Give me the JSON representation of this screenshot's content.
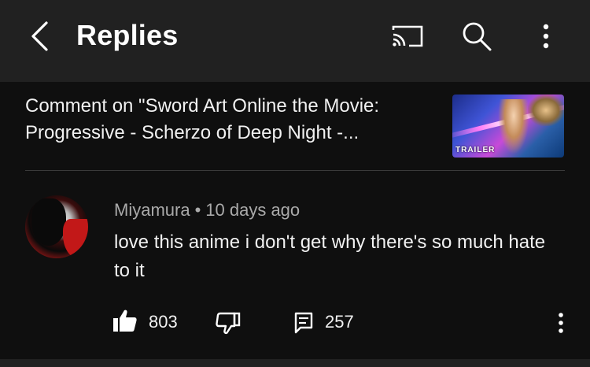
{
  "header": {
    "title": "Replies",
    "back_icon": "chevron-left-icon",
    "cast_icon": "cast-icon",
    "search_icon": "search-icon",
    "more_icon": "more-vert-icon"
  },
  "context": {
    "line1": "Comment on \"Sword Art Online the Movie:",
    "line2": "Progressive - Scherzo of Deep Night -...",
    "thumbnail_badge": "TRAILER"
  },
  "comment": {
    "author": "Miyamura",
    "separator": "•",
    "time": "10 days ago",
    "text": "love this anime i don't get why there's so much hate to it",
    "likes": "803",
    "replies": "257",
    "like_icon": "thumbs-up-icon",
    "dislike_icon": "thumbs-down-icon",
    "reply_icon": "comment-icon"
  },
  "colors": {
    "background": "#0f0f0f",
    "header_bg": "#212121",
    "text_primary": "#f1f1f1",
    "text_secondary": "#aaaaaa"
  }
}
